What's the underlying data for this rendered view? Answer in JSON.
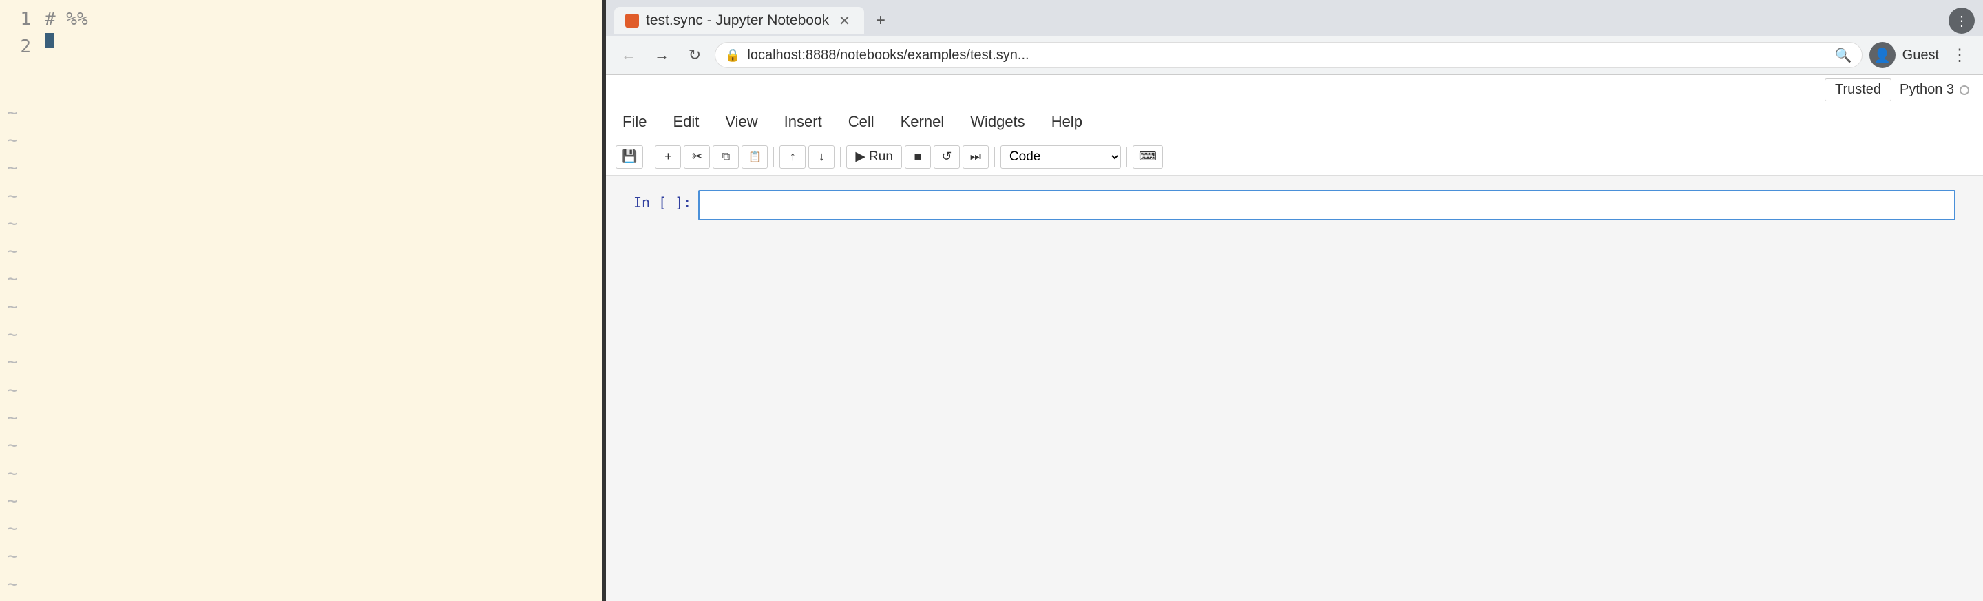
{
  "editor": {
    "background": "#fdf6e3",
    "lines": [
      {
        "number": "1",
        "content": "# %%",
        "type": "code"
      },
      {
        "number": "2",
        "content": "",
        "type": "cursor"
      }
    ],
    "tildes": [
      "~",
      "~",
      "~",
      "~",
      "~",
      "~",
      "~",
      "~",
      "~",
      "~",
      "~",
      "~",
      "~",
      "~",
      "~",
      "~",
      "~",
      "~"
    ]
  },
  "browser": {
    "tab": {
      "title": "test.sync - Jupyter Notebook",
      "favicon_color": "#e05c2a"
    },
    "address": "localhost:8888/notebooks/examples/test.syn...",
    "user": "Guest"
  },
  "jupyter": {
    "trusted_label": "Trusted",
    "kernel_label": "Python 3",
    "menu": [
      "File",
      "Edit",
      "View",
      "Insert",
      "Cell",
      "Kernel",
      "Widgets",
      "Help"
    ],
    "toolbar": {
      "save": "💾",
      "add": "+",
      "cut": "✂",
      "copy": "⊡",
      "paste": "📋",
      "move_up": "↑",
      "move_down": "↓",
      "run": "Run",
      "stop": "■",
      "restart": "↺",
      "restart_run": "⏭",
      "cell_type": "Code",
      "keyboard": "⌨"
    },
    "cell": {
      "prompt": "In [ ]:",
      "content": ""
    }
  }
}
